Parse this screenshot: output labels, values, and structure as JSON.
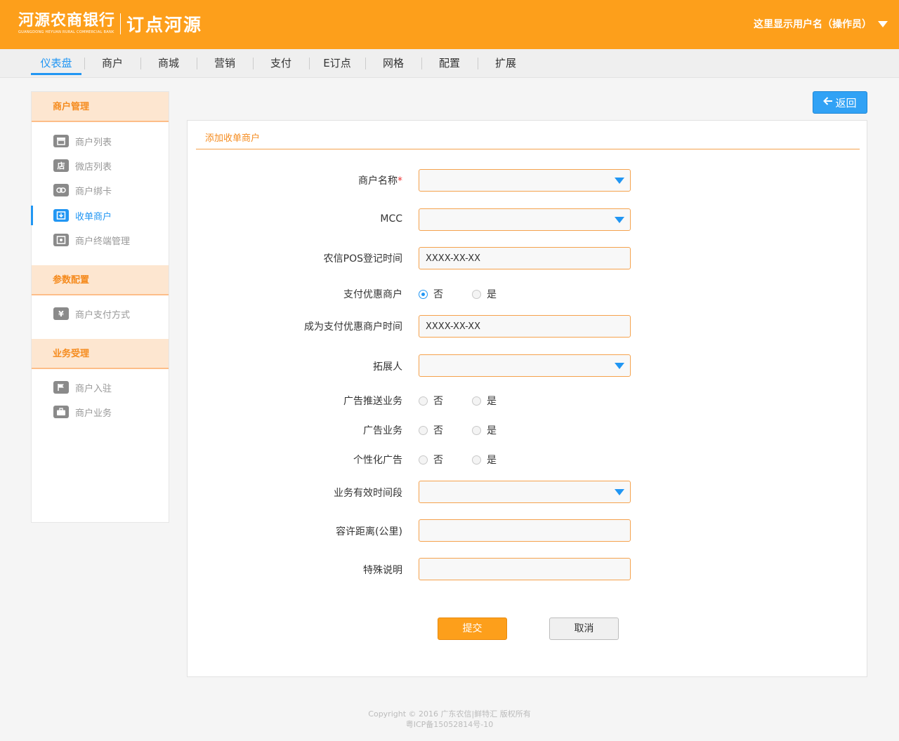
{
  "header": {
    "bank_name": "河源农商银行",
    "bank_name_en": "GUANGDONG HEYUAN RURAL COMMERCIAL BANK",
    "product_name": "订点河源",
    "user_label": "这里显示用户名（操作员）"
  },
  "nav": {
    "items": [
      {
        "label": "仪表盘",
        "active": true
      },
      {
        "label": "商户"
      },
      {
        "label": "商城"
      },
      {
        "label": "营销"
      },
      {
        "label": "支付"
      },
      {
        "label": "E订点"
      },
      {
        "label": "网格"
      },
      {
        "label": "配置"
      },
      {
        "label": "扩展"
      }
    ]
  },
  "sidebar": {
    "sections": [
      {
        "title": "商户管理",
        "items": [
          {
            "label": "商户列表",
            "icon": "store-icon"
          },
          {
            "label": "微店列表",
            "icon": "shop-icon",
            "glyph": "店"
          },
          {
            "label": "商户绑卡",
            "icon": "link-icon"
          },
          {
            "label": "收单商户",
            "icon": "download-icon",
            "active": true
          },
          {
            "label": "商户终端管理",
            "icon": "terminal-icon"
          }
        ]
      },
      {
        "title": "参数配置",
        "items": [
          {
            "label": "商户支付方式",
            "icon": "yen-icon",
            "glyph": "¥"
          }
        ]
      },
      {
        "title": "业务受理",
        "items": [
          {
            "label": "商户入驻",
            "icon": "flag-icon"
          },
          {
            "label": "商户业务",
            "icon": "briefcase-icon"
          }
        ]
      }
    ]
  },
  "back_button": {
    "label": "返回",
    "icon": "arrow-left-icon"
  },
  "form": {
    "title": "添加收单商户",
    "merchant_name": {
      "label": "商户名称",
      "required_mark": "*",
      "value": ""
    },
    "mcc": {
      "label": "MCC",
      "value": ""
    },
    "pos_reg_time": {
      "label": "农信POS登记时间",
      "placeholder": "XXXX-XX-XX"
    },
    "pay_discount": {
      "label": "支付优惠商户",
      "no": "否",
      "yes": "是",
      "selected": "否"
    },
    "discount_time": {
      "label": "成为支付优惠商户时间",
      "placeholder": "XXXX-XX-XX"
    },
    "expander": {
      "label": "拓展人",
      "value": ""
    },
    "ad_push": {
      "label": "广告推送业务",
      "no": "否",
      "yes": "是",
      "selected": ""
    },
    "ad_business": {
      "label": "广告业务",
      "no": "否",
      "yes": "是",
      "selected": ""
    },
    "personal_ad": {
      "label": "个性化广告",
      "no": "否",
      "yes": "是",
      "selected": ""
    },
    "valid_period": {
      "label": "业务有效时间段",
      "value": ""
    },
    "tolerance": {
      "label": "容许距离(公里)",
      "value": ""
    },
    "notes": {
      "label": "特殊说明",
      "value": ""
    },
    "submit_label": "提交",
    "cancel_label": "取消"
  },
  "footer": {
    "copyright": "Copyright © 2016 广东农信|鲜特汇 版权所有",
    "icp": "粤ICP备15052814号-10"
  },
  "colors": {
    "brand_orange": "#fd9f1b",
    "accent_blue": "#2196f3",
    "sidebar_section_bg": "#fde6d0"
  }
}
